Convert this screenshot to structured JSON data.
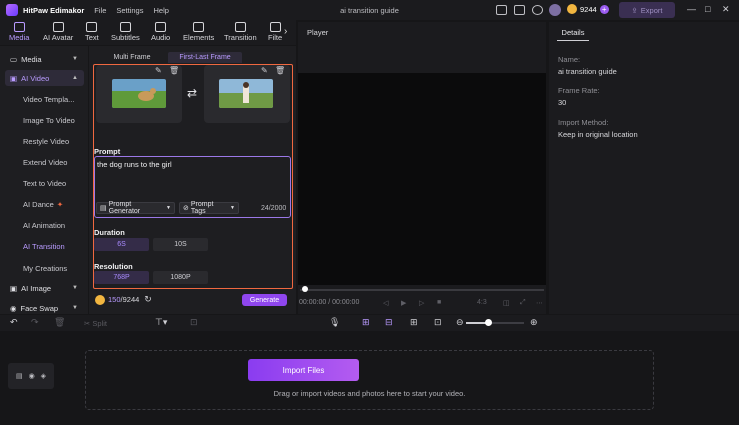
{
  "app": {
    "name": "HitPaw Edimakor",
    "menus": [
      "File",
      "Settings",
      "Help"
    ],
    "project_title": "ai transition guide",
    "credits": "9244",
    "export_label": "Export"
  },
  "toolbar": {
    "tabs": [
      "Media",
      "AI Avatar",
      "Text",
      "Subtitles",
      "Audio",
      "Elements",
      "Transition",
      "Filte"
    ],
    "active": "Media"
  },
  "sidebar": {
    "media": "Media",
    "ai_video": "AI Video",
    "sub_items": [
      "Video Templa...",
      "Image To Video",
      "Restyle Video",
      "Extend Video",
      "Text to Video",
      "AI Dance",
      "AI Animation",
      "AI Transition",
      "My Creations"
    ],
    "active_sub": "AI Transition",
    "ai_image": "AI Image",
    "face_swap": "Face Swap"
  },
  "panel": {
    "tabs": [
      "Multi Frame",
      "First-Last Frame"
    ],
    "active_tab": "First-Last Frame",
    "prompt_label": "Prompt",
    "prompt_text": "the dog runs to the girl",
    "prompt_generator": "Prompt Generator",
    "prompt_tags": "Prompt Tags",
    "char_count": "24/2000",
    "duration_label": "Duration",
    "duration_options": [
      "6S",
      "10S"
    ],
    "duration_selected": "6S",
    "resolution_label": "Resolution",
    "resolution_options": [
      "768P",
      "1080P"
    ],
    "resolution_selected": "768P",
    "credit_used": "150",
    "credit_total": "/9244",
    "generate_label": "Generate"
  },
  "player": {
    "title": "Player",
    "timecode": "00:00:00 / 00:00:00",
    "aspect": "4:3"
  },
  "details": {
    "tab": "Details",
    "fields": [
      {
        "key": "Name:",
        "value": "ai transition guide"
      },
      {
        "key": "Frame Rate:",
        "value": "30"
      },
      {
        "key": "Import Method:",
        "value": "Keep in original location"
      }
    ]
  },
  "timeline": {
    "split_label": "Split",
    "import_label": "Import Files",
    "drop_hint": "Drag or import videos and photos here to start your video."
  },
  "colors": {
    "accent": "#8f46ee",
    "highlight_border": "#f06840",
    "active_text": "#b99bff"
  }
}
